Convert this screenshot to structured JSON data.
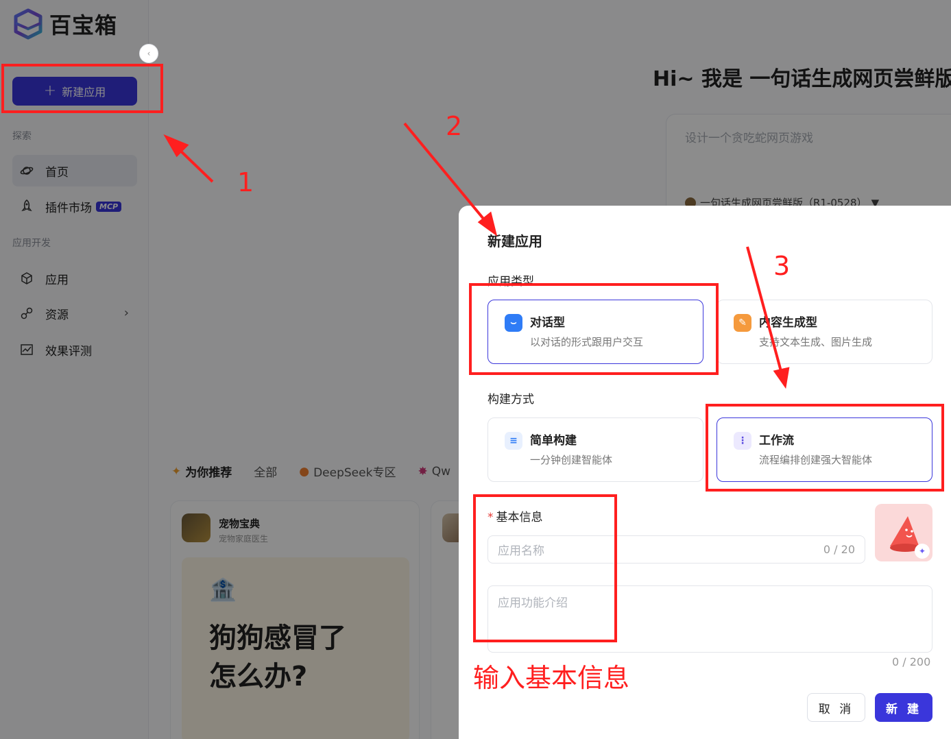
{
  "app": {
    "logo_text": "百宝箱",
    "collapse_glyph": "‹"
  },
  "sidebar": {
    "new_app_label": "新建应用",
    "section_explore": "探索",
    "section_dev": "应用开发",
    "items": [
      {
        "label": "首页",
        "icon": "planet-icon"
      },
      {
        "label": "插件市场",
        "icon": "rocket-icon",
        "badge": "MCP"
      },
      {
        "label": "应用",
        "icon": "cube-icon"
      },
      {
        "label": "资源",
        "icon": "link-icon"
      },
      {
        "label": "效果评测",
        "icon": "chart-icon"
      }
    ]
  },
  "main": {
    "hero": "Hi~ 我是 一句话生成网页尝鲜版",
    "prompt_placeholder": "设计一个贪吃蛇网页游戏",
    "model": "一句话生成网页尝鲜版（R1-0528）",
    "tabs": [
      "为你推荐",
      "全部",
      "DeepSeek专区",
      "Qw"
    ],
    "card": {
      "title": "宠物宝典",
      "subtitle": "宠物家庭医生",
      "headline_1": "狗狗感冒了",
      "headline_2": "怎么办?"
    }
  },
  "dialog": {
    "title": "新建应用",
    "type_label": "应用类型",
    "types": [
      {
        "title": "对话型",
        "desc": "以对话的形式跟用户交互"
      },
      {
        "title": "内容生成型",
        "desc": "支持文本生成、图片生成"
      }
    ],
    "build_label": "构建方式",
    "builds": [
      {
        "title": "简单构建",
        "desc": "一分钟创建智能体"
      },
      {
        "title": "工作流",
        "desc": "流程编排创建强大智能体"
      }
    ],
    "basic_label": "基本信息",
    "name_placeholder": "应用名称",
    "name_count": "0 / 20",
    "desc_placeholder": "应用功能介绍",
    "desc_count": "0 / 200",
    "cancel": "取 消",
    "create": "新 建"
  },
  "annotations": {
    "n1": "1",
    "n2": "2",
    "n3": "3",
    "note": "输入基本信息"
  },
  "colors": {
    "accent": "#3a36db",
    "annotation": "#ff1f1f"
  }
}
